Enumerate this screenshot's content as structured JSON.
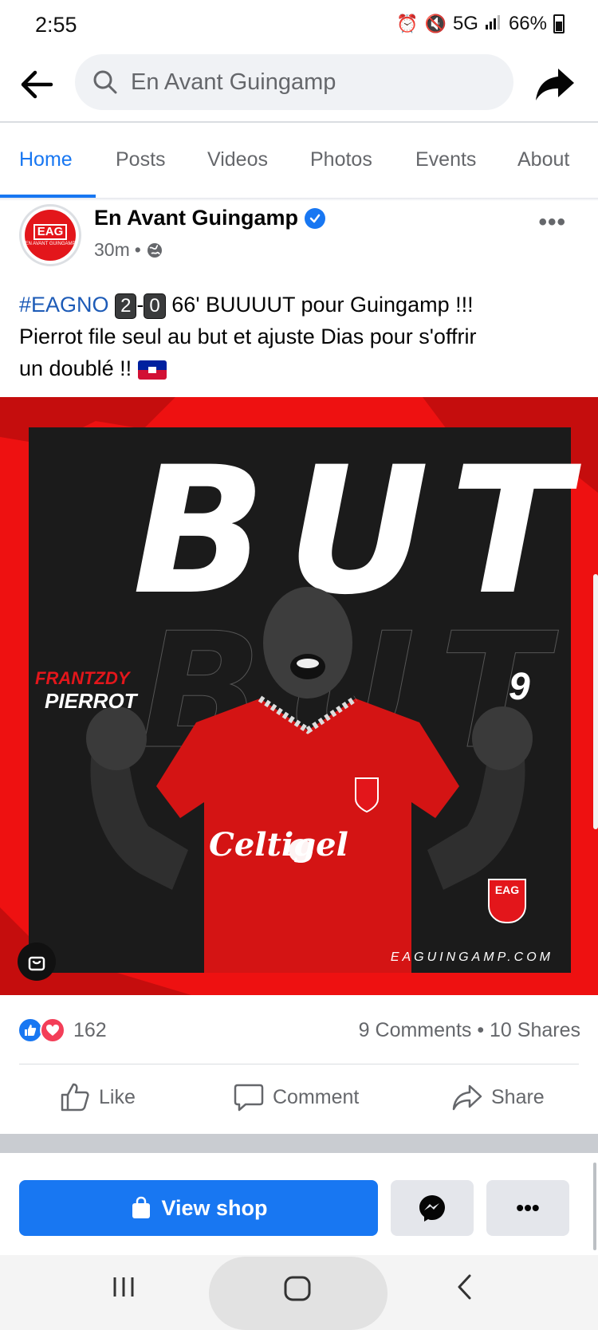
{
  "status": {
    "time": "2:55",
    "network": "5G",
    "battery": "66%"
  },
  "header": {
    "search_text": "En Avant Guingamp"
  },
  "tabs": [
    {
      "label": "Home",
      "active": true
    },
    {
      "label": "Posts"
    },
    {
      "label": "Videos"
    },
    {
      "label": "Photos"
    },
    {
      "label": "Events"
    },
    {
      "label": "About"
    }
  ],
  "post": {
    "author": "En Avant Guingamp",
    "avatar_text": "EAG",
    "avatar_sub": "EN AVANT GUINGAMP",
    "time": "30m",
    "hashtag": "#EAGNO",
    "score_home": "2",
    "score_sep": "-",
    "score_away": "0",
    "text_line1_rest": " 66' BUUUUT pour Guingamp !!!",
    "text_line2": "Pierrot file seul au but et ajuste Dias pour s'offrir",
    "text_line3": "un doublé !! ",
    "image": {
      "headline": "BUT",
      "player_first": "FRANTZDY",
      "player_last": "PIERROT",
      "player_number": "9",
      "site": "EAGUINGAMP.COM",
      "logo_text": "EAG",
      "sponsor": "Celtigel"
    },
    "reaction_count": "162",
    "comments_shares": "9 Comments • 10 Shares",
    "actions": {
      "like": "Like",
      "comment": "Comment",
      "share": "Share"
    }
  },
  "bottom": {
    "view_shop": "View shop",
    "more": "•••"
  },
  "colors": {
    "accent": "#1877f2",
    "brand_red": "#e3161b"
  }
}
